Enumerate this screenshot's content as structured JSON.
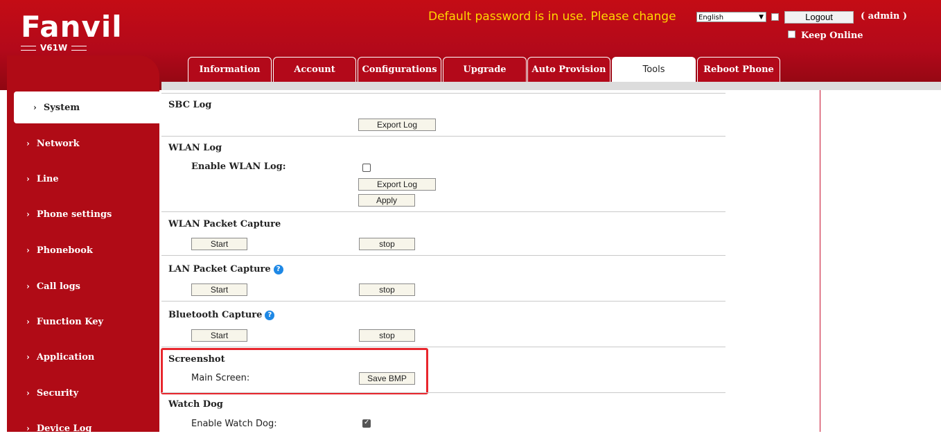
{
  "brand": {
    "logo": "Fanvil",
    "model": "V61W"
  },
  "header": {
    "warning": "Default password is in use. Please change",
    "language": "English",
    "logout_label": "Logout",
    "user": "( admin )",
    "keep_online_label": "Keep Online"
  },
  "tabs": [
    {
      "label": "Information"
    },
    {
      "label": "Account"
    },
    {
      "label": "Configurations"
    },
    {
      "label": "Upgrade"
    },
    {
      "label": "Auto Provision"
    },
    {
      "label": "Tools"
    },
    {
      "label": "Reboot Phone"
    }
  ],
  "active_tab": "Tools",
  "sidebar": {
    "items": [
      {
        "label": "System",
        "active": true
      },
      {
        "label": "Network"
      },
      {
        "label": "Line"
      },
      {
        "label": "Phone settings"
      },
      {
        "label": "Phonebook"
      },
      {
        "label": "Call logs"
      },
      {
        "label": "Function Key"
      },
      {
        "label": "Application"
      },
      {
        "label": "Security"
      },
      {
        "label": "Device Log"
      }
    ]
  },
  "sections": {
    "sbc_log": {
      "title": "SBC Log",
      "export_label": "Export Log"
    },
    "wlan_log": {
      "title": "WLAN Log",
      "enable_label": "Enable WLAN Log:",
      "enabled": false,
      "export_label": "Export Log",
      "apply_label": "Apply"
    },
    "wlan_capture": {
      "title": "WLAN Packet Capture",
      "start_label": "Start",
      "stop_label": "stop"
    },
    "lan_capture": {
      "title": "LAN Packet Capture",
      "start_label": "Start",
      "stop_label": "stop"
    },
    "bt_capture": {
      "title": "Bluetooth Capture",
      "start_label": "Start",
      "stop_label": "stop"
    },
    "screenshot": {
      "title": "Screenshot",
      "main_screen_label": "Main Screen:",
      "save_label": "Save BMP"
    },
    "watchdog": {
      "title": "Watch Dog",
      "enable_label": "Enable Watch Dog:",
      "enabled": true
    }
  },
  "colors": {
    "brand_red": "#b3091a",
    "warning_yellow": "#ffd700",
    "highlight_red": "#e8262d",
    "help_blue": "#1e88e5"
  }
}
